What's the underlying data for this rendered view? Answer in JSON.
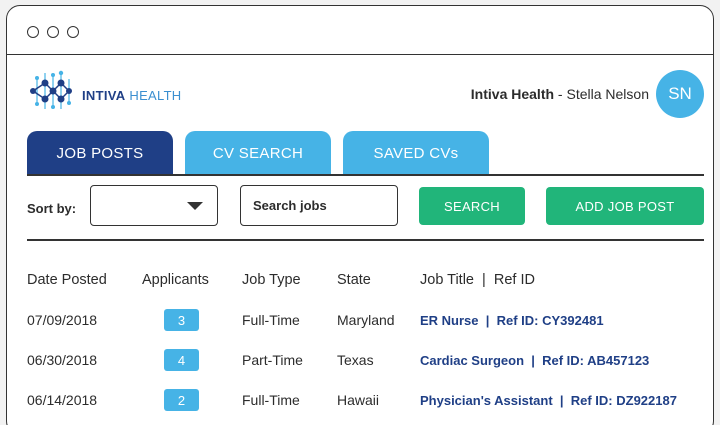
{
  "brand": {
    "name_bold": "INTIVA",
    "name_light": "HEALTH"
  },
  "user": {
    "org": "Intiva Health",
    "separator": " - ",
    "name": "Stella Nelson",
    "initials": "SN"
  },
  "tabs": [
    {
      "label": "JOB POSTS",
      "active": true
    },
    {
      "label": "CV SEARCH",
      "active": false
    },
    {
      "label": "SAVED CVs",
      "active": false
    }
  ],
  "toolbar": {
    "sort_label": "Sort by:",
    "sort_value": "",
    "search_placeholder": "Search jobs",
    "search_button": "SEARCH",
    "add_button": "ADD JOB POST"
  },
  "table": {
    "headers": [
      "Date Posted",
      "Applicants",
      "Job Type",
      "State",
      "Job Title  |  Ref ID"
    ],
    "rows": [
      {
        "date": "07/09/2018",
        "applicants": "3",
        "type": "Full-Time",
        "state": "Maryland",
        "title": "ER Nurse  |  Ref ID: CY392481"
      },
      {
        "date": "06/30/2018",
        "applicants": "4",
        "type": "Part-Time",
        "state": "Texas",
        "title": "Cardiac Surgeon  |  Ref ID: AB457123"
      },
      {
        "date": "06/14/2018",
        "applicants": "2",
        "type": "Full-Time",
        "state": "Hawaii",
        "title": "Physician's Assistant  |  Ref ID: DZ922187"
      }
    ]
  },
  "colors": {
    "navy": "#1f3f86",
    "light_blue": "#46b3e6",
    "green": "#21b57a"
  }
}
